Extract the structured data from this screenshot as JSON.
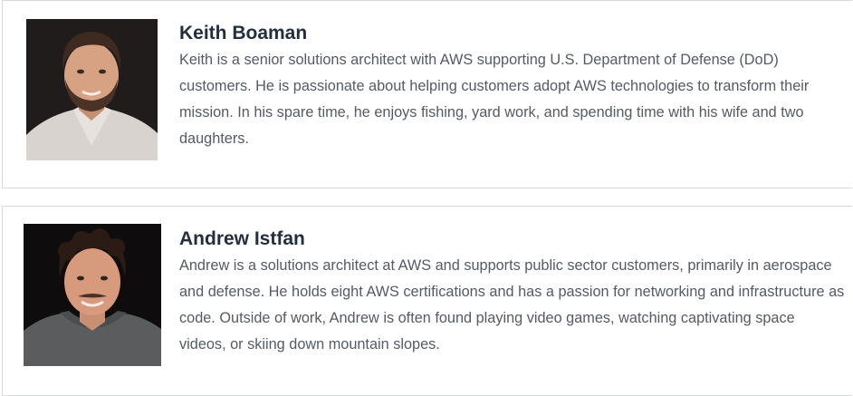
{
  "bios": [
    {
      "name": "Keith Boaman",
      "description": "Keith is a senior solutions architect with AWS supporting U.S. Department of Defense (DoD) customers. He is passionate about helping customers adopt AWS technologies to transform their mission. In his spare time, he enjoys fishing, yard work, and spending time with his wife and two daughters.",
      "photo": "headshot-photo"
    },
    {
      "name": "Andrew Istfan",
      "description": "Andrew is a solutions architect at AWS and supports public sector customers, primarily in aerospace and defense. He holds eight AWS certifications and has a passion for networking and infrastructure as code. Outside of work, Andrew is often found playing video games, watching captivating space videos, or skiing down mountain slopes.",
      "photo": "headshot-photo"
    }
  ],
  "colors": {
    "name_text": "#232f3e",
    "body_text": "#545b64",
    "card_border": "#d5dbdb"
  }
}
